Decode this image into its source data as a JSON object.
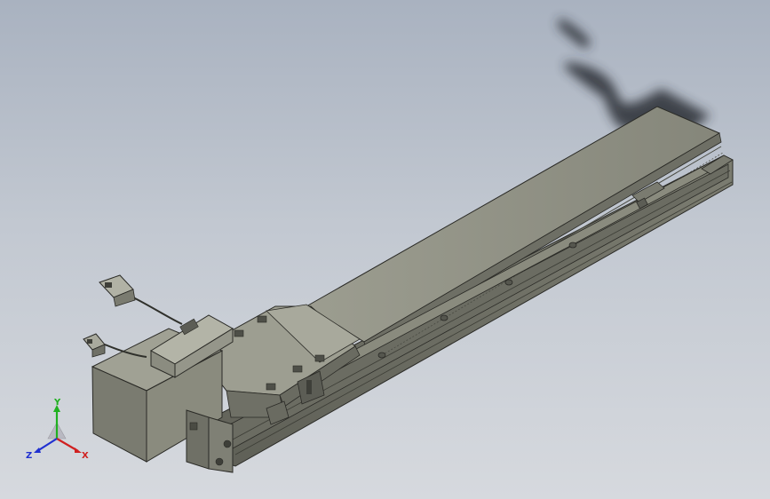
{
  "viewport": {
    "background_top": "#a9b2c0",
    "background_bottom": "#d6d9de"
  },
  "model": {
    "body_color": "#8a8b7e",
    "top_color": "#a3a497",
    "edge_color": "#2a2a26",
    "shadow_color": "#2c2f36"
  },
  "triad": {
    "x_label": "X",
    "y_label": "Y",
    "z_label": "Z",
    "x_color": "#d02020",
    "y_color": "#20b020",
    "z_color": "#2030d0"
  }
}
